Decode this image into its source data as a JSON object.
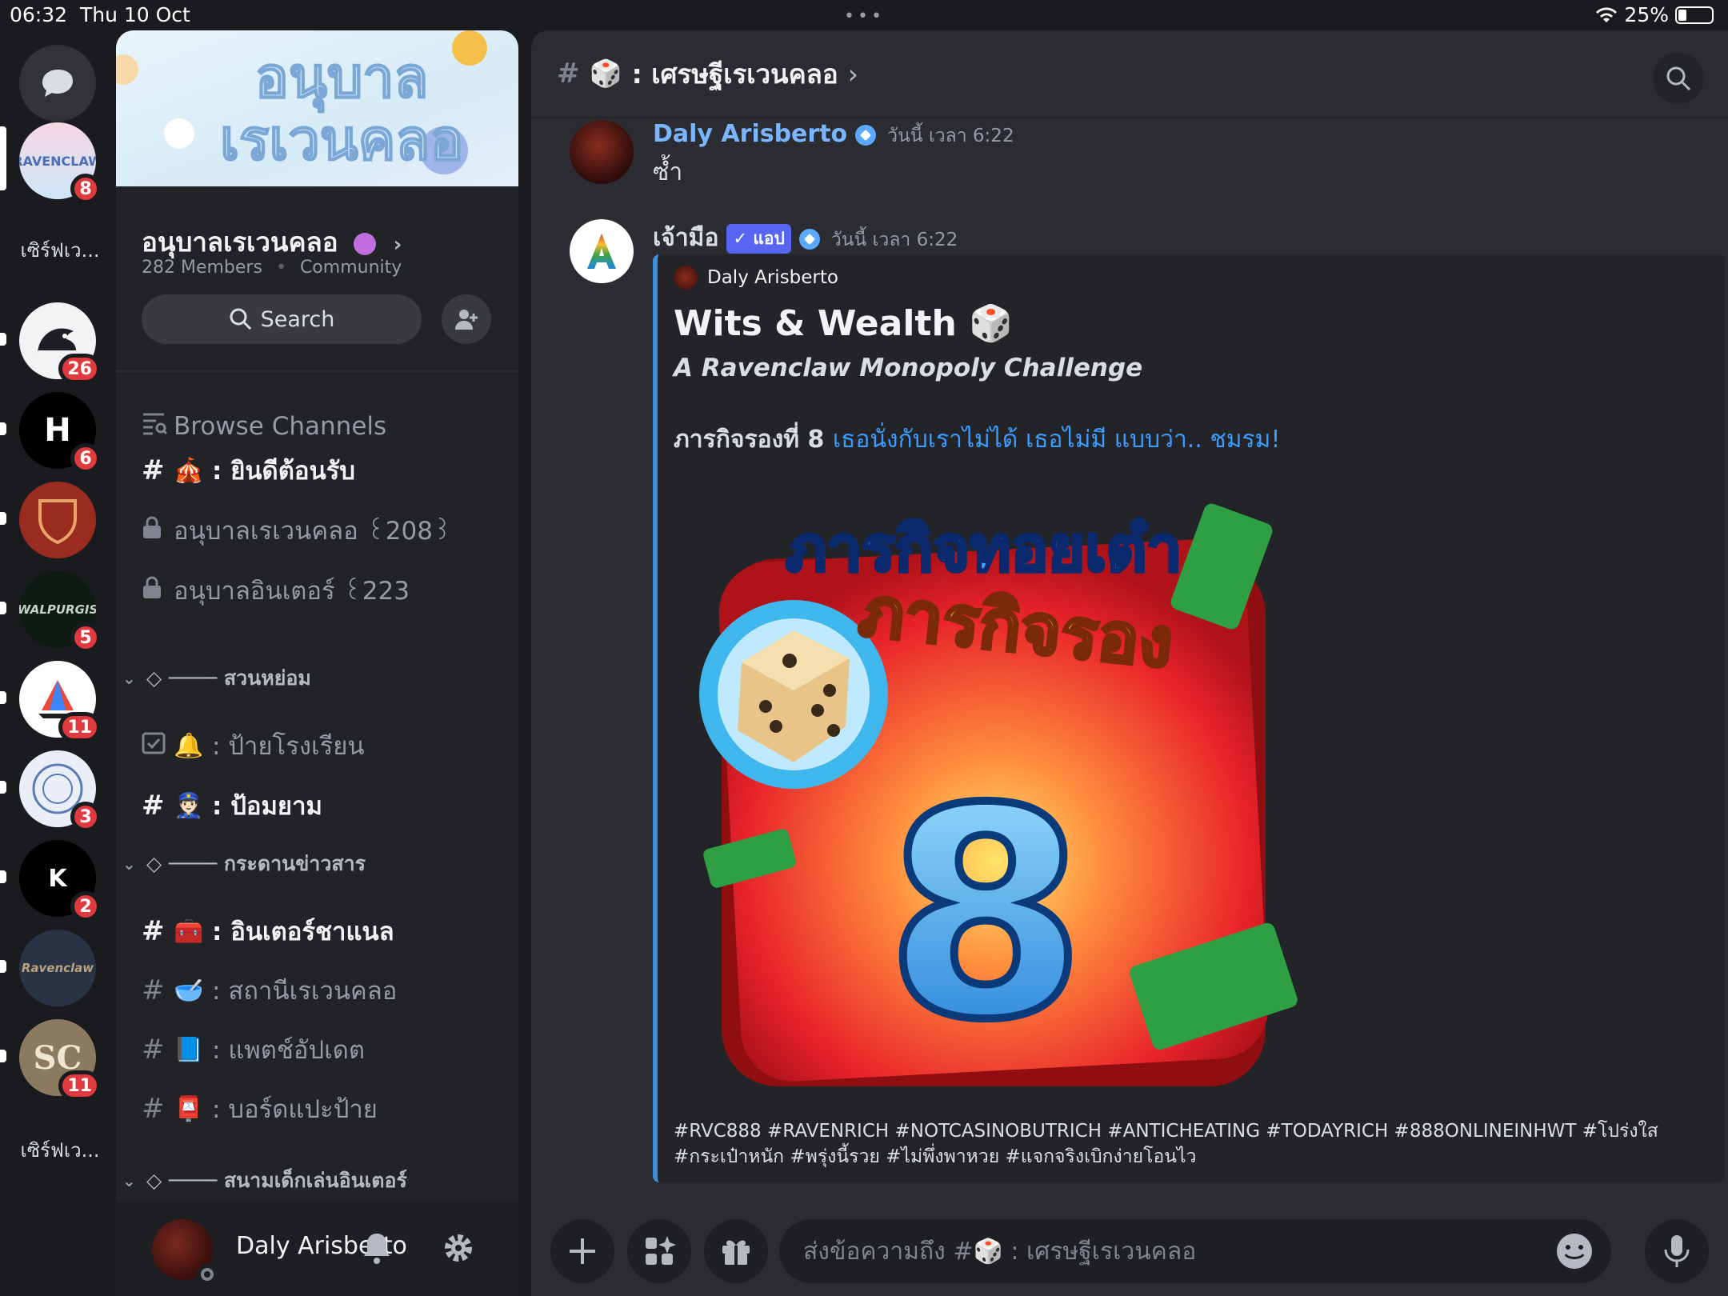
{
  "status_bar": {
    "time": "06:32",
    "date": "Thu 10 Oct",
    "battery": "25%",
    "battery_level": 0.25
  },
  "rail": {
    "dm_icon": "chat-bubble-icon",
    "guilds": [
      {
        "name": "RAVENCLAW KINDERGARTEN",
        "badge": "8",
        "bg": "#f7c9d8"
      },
      {
        "name": "เซิร์ฟเว...",
        "text_only": true
      },
      {
        "name": "bird server",
        "badge": "26",
        "bg": "#f2f3f5"
      },
      {
        "name": "HOGTHAI",
        "badge": "6",
        "bg": "#000000"
      },
      {
        "name": "house crest",
        "bg": "#9a2b1f"
      },
      {
        "name": "WALPURGIS",
        "badge": "5",
        "bg": "#0f1a12"
      },
      {
        "name": "sailboat",
        "badge": "11",
        "bg": "#ffffff"
      },
      {
        "name": "crest seal",
        "badge": "3",
        "bg": "#e9eef7"
      },
      {
        "name": "K",
        "badge": "2",
        "bg": "#000000"
      },
      {
        "name": "Ravenclaw",
        "bg": "#2a3346"
      },
      {
        "name": "SC",
        "badge": "11",
        "bg": "#8b7a5f"
      },
      {
        "name": "เซิร์ฟเว...",
        "text_only": true
      }
    ],
    "texts": {
      "g1": "เซิร์ฟเว...",
      "g2": "เซิร์ฟเว..."
    }
  },
  "sidebar": {
    "banner_text": "อนุบาล\nเรเวนคลอ",
    "server_name": "อนุบาลเรเวนคลอ",
    "members": "282 Members",
    "community": "Community",
    "search_label": "Search",
    "browse_channels": "Browse Channels",
    "channels": [
      {
        "name": "ยินดีต้อนรับ",
        "emoji": "🎪",
        "kind": "text",
        "unread": true
      },
      {
        "name": "อนุบาลเรเวนคลอ ꒰208꒱",
        "kind": "locked"
      },
      {
        "name": "อนุบาลอินเตอร์ ꒰223",
        "kind": "locked"
      }
    ],
    "cat1": "◇ ──── สวนหย่อม",
    "cat1_channels": [
      {
        "name": "ป้ายโรงเรียน",
        "emoji": "🔔",
        "kind": "rules"
      },
      {
        "name": "ป้อมยาม",
        "emoji": "👮🏻",
        "kind": "text",
        "unread": true
      }
    ],
    "cat2": "◇ ──── กระดานข่าวสาร",
    "cat2_channels": [
      {
        "name": "อินเตอร์ชาแนล",
        "emoji": "🧰",
        "kind": "text",
        "unread": true
      },
      {
        "name": "สถานีเรเวนคลอ",
        "emoji": "🥣",
        "kind": "announce"
      },
      {
        "name": "แพตช์อัปเดต",
        "emoji": "📘",
        "kind": "announce"
      },
      {
        "name": "บอร์ดแปะป้าย",
        "emoji": "📮",
        "kind": "announce"
      }
    ],
    "cat3": "◇ ──── สนามเด็กเล่นอินเตอร์"
  },
  "userbar": {
    "username": "Daly Arisberto"
  },
  "header": {
    "channel_emoji": "🎲",
    "channel_name": ": เศรษฐีเรเวนคลอ",
    "chevron": "›"
  },
  "messages": [
    {
      "author": "Daly Arisberto",
      "time": "วันนี้ เวลา 6:22",
      "text": "ซ้ำ",
      "color": "#7ab6ff"
    },
    {
      "author": "เจ้ามือ",
      "app_tag": "✓ แอป",
      "time": "วันนี้ เวลา 6:22",
      "color": "#dbdee1"
    }
  ],
  "embed": {
    "author": "Daly Arisberto",
    "title": "Wits & Wealth 🎲",
    "subtitle": "A Ravenclaw Monopoly Challenge",
    "desc_prefix": "ภารกิจรองที่ 8",
    "desc_link": "เธอนั่งกับเราไม่ได้ เธอไม่มี แบบว่า.. ชมรม!",
    "image_line1": "ภารกิจทอยเต๋า",
    "image_line2": "ภารกิจรอง",
    "image_number": "8",
    "tags": "#RVC888 #RAVENRICH #NOTCASINOBUTRICH #ANTICHEATING #TODAYRICH #888ONLINEINHWT #โปร่งใส #กระเป๋าหนัก #พรุ่งนี้รวย #ไม่พึ่งพาหวย #แจกจริงเบิกง่ายโอนไว"
  },
  "composer": {
    "placeholder": "ส่งข้อความถึง #🎲 : เศรษฐีเรเวนคลอ"
  }
}
